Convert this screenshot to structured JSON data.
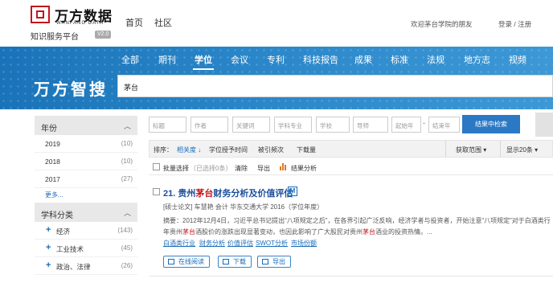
{
  "header": {
    "logo_cn": "万方数据",
    "logo_en": "WANFANG DATA",
    "logo_sub": "知识服务平台",
    "logo_version": "V2.0",
    "top_links": [
      "首页",
      "社区"
    ],
    "welcome": "欢迎茅台学院的朋友",
    "login": "登录 / 注册"
  },
  "banner": {
    "nav": [
      "全部",
      "期刊",
      "学位",
      "会议",
      "专利",
      "科技报告",
      "成果",
      "标准",
      "法规",
      "地方志",
      "视频"
    ],
    "active_nav": "学位",
    "brand": "万方智搜",
    "search_value": "茅台"
  },
  "sidebar": {
    "year_title": "年份",
    "years": [
      {
        "label": "2019",
        "count": "(10)"
      },
      {
        "label": "2018",
        "count": "(10)"
      },
      {
        "label": "2017",
        "count": "(27)"
      }
    ],
    "more": "更多...",
    "subject_title": "学科分类",
    "subjects": [
      {
        "label": "经济",
        "count": "(143)"
      },
      {
        "label": "工业技术",
        "count": "(45)"
      },
      {
        "label": "政治、法律",
        "count": "(26)"
      }
    ]
  },
  "filters": {
    "fields": [
      "标题",
      "作者",
      "关键词",
      "学科专业",
      "学校",
      "导师"
    ],
    "year_from": "起始年",
    "dash": "-",
    "year_to": "结束年",
    "button": "结果中检索"
  },
  "sortbar": {
    "label": "排序：",
    "options": [
      "相关度",
      "学位授予时间",
      "被引频次",
      "下载量"
    ],
    "active": "相关度",
    "range": "获取范围",
    "per_page": "显示20条"
  },
  "batchbar": {
    "select": "批量选择",
    "selected": "（已选择0条）",
    "clear": "清除",
    "export": "导出",
    "analysis": "结果分析"
  },
  "result": {
    "number": "21.",
    "title_pre": "贵州",
    "title_hl": "茅台",
    "title_post": "财务分析及价值评估",
    "badge": "M",
    "meta": "[硕士论文]   车慧艳   会计  华东交通大学  2016（学位年度）",
    "abstract_line1": "摘要：2012年12月4日，习近平总书记提出“八项规定之后”，在各界引起广泛反响，经济学者与投资者，开始注意“八项规定”对于白酒类行",
    "abstract_line2_pre": "年贵州",
    "abstract_line2_hl1": "茅台",
    "abstract_line2_mid": "酒股价的涨跌出现显著变动，也因此影响了广大股民对贵州",
    "abstract_line2_hl2": "茅台",
    "abstract_line2_post": "酒业的投资热情。...",
    "keywords": [
      "白酒类行业",
      "财务分析",
      "价值评估",
      "SWOT分析",
      "市场份额"
    ],
    "actions": [
      "在线阅读",
      "下载",
      "导出"
    ]
  }
}
